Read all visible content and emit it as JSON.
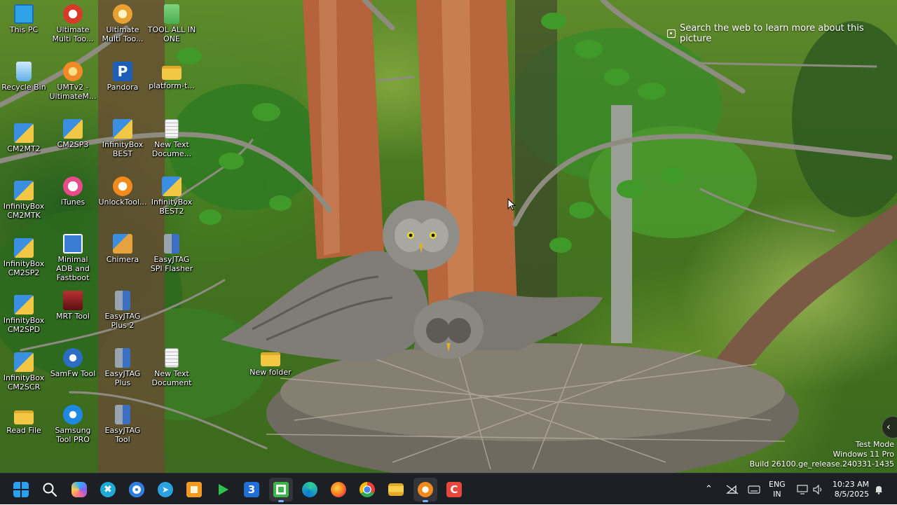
{
  "desktop": {
    "icons": [
      {
        "label": "This PC",
        "icon": "computer-icon",
        "color": "#2fa3e8"
      },
      {
        "label": "Ultimate Multi Too...",
        "icon": "umt-icon",
        "color": "#d7392b"
      },
      {
        "label": "Ultimate Multi Too...",
        "icon": "umt-icon",
        "color": "#e8a030"
      },
      {
        "label": "TOOL ALL IN ONE",
        "icon": "tool-icon",
        "color": "#4caf50"
      },
      {
        "label": "Recycle Bin",
        "icon": "recycle-bin-icon",
        "color": "#5fb0e8"
      },
      {
        "label": "UMTv2 - UltimateM...",
        "icon": "umt-icon",
        "color": "#f08a24"
      },
      {
        "label": "Pandora",
        "icon": "pandora-icon",
        "color": "#1d5fb8"
      },
      {
        "label": "platform-t...",
        "icon": "folder-icon",
        "color": "#f2c744"
      },
      {
        "label": "CM2MT2",
        "icon": "infinity-icon",
        "color": "#3b8fe0"
      },
      {
        "label": "CM2SP3",
        "icon": "infinity-icon",
        "color": "#3b8fe0"
      },
      {
        "label": "InfinityBox BEST",
        "icon": "infinity-icon",
        "color": "#3b8fe0"
      },
      {
        "label": "New Text Docume...",
        "icon": "text-document-icon",
        "color": "#f4f4f4"
      },
      {
        "label": "InfinityBox CM2MTK",
        "icon": "infinity-icon",
        "color": "#3b8fe0"
      },
      {
        "label": "iTunes",
        "icon": "itunes-icon",
        "color": "#e94b8a"
      },
      {
        "label": "UnlockTool...",
        "icon": "unlocktool-icon",
        "color": "#f28a1c"
      },
      {
        "label": "InfinityBox BEST2",
        "icon": "infinity-icon",
        "color": "#3b8fe0"
      },
      {
        "label": "InfinityBox CM2SP2",
        "icon": "infinity-icon",
        "color": "#3b8fe0"
      },
      {
        "label": "Minimal ADB and Fastboot",
        "icon": "adb-icon",
        "color": "#3a7bd5"
      },
      {
        "label": "Chimera",
        "icon": "chimera-icon",
        "color": "#e6a23c"
      },
      {
        "label": "EasyJTAG SPI Flasher",
        "icon": "easyjtag-icon",
        "color": "#9aa4b0"
      },
      {
        "label": "InfinityBox CM2SPD",
        "icon": "infinity-icon",
        "color": "#3b8fe0"
      },
      {
        "label": "MRT Tool",
        "icon": "mrt-icon",
        "color": "#b83232"
      },
      {
        "label": "EasyJTAG Plus 2",
        "icon": "easyjtag-icon",
        "color": "#9aa4b0"
      },
      {
        "label": "InfinityBox CM2SCR",
        "icon": "infinity-icon",
        "color": "#3b8fe0"
      },
      {
        "label": "SamFw Tool",
        "icon": "samfw-icon",
        "color": "#2b6cc4"
      },
      {
        "label": "EasyJTAG Plus",
        "icon": "easyjtag-icon",
        "color": "#9aa4b0"
      },
      {
        "label": "New Text Document",
        "icon": "text-document-icon",
        "color": "#f4f4f4"
      },
      {
        "label": "New folder",
        "icon": "folder-icon",
        "color": "#f2c744"
      },
      {
        "label": "Read File",
        "icon": "folder-icon",
        "color": "#f2c744"
      },
      {
        "label": "Samsung Tool PRO",
        "icon": "samsung-tool-icon",
        "color": "#1e88e5"
      },
      {
        "label": "EasyJTAG Tool",
        "icon": "easyjtag-icon",
        "color": "#9aa4b0"
      }
    ],
    "spotlight_text": "Search the web to learn more about this picture",
    "watermark": {
      "line1": "Test Mode",
      "line2": "Windows 11 Pro",
      "line3": "Build 26100.ge_release.240331-1435"
    }
  },
  "taskbar": {
    "apps": [
      {
        "name": "start",
        "icon": "windows-logo-icon"
      },
      {
        "name": "search",
        "icon": "search-icon"
      },
      {
        "name": "copilot",
        "icon": "copilot-icon"
      },
      {
        "name": "snipping-tool",
        "icon": "snipping-tool-icon"
      },
      {
        "name": "messaging",
        "icon": "chat-icon"
      },
      {
        "name": "telegram",
        "icon": "telegram-icon"
      },
      {
        "name": "recorder",
        "icon": "recorder-icon"
      },
      {
        "name": "play",
        "icon": "play-icon"
      },
      {
        "name": "app-3",
        "icon": "three-icon"
      },
      {
        "name": "camtasia",
        "icon": "camtasia-icon"
      },
      {
        "name": "edge",
        "icon": "edge-icon"
      },
      {
        "name": "firefox",
        "icon": "firefox-icon"
      },
      {
        "name": "chrome",
        "icon": "chrome-icon"
      },
      {
        "name": "file-explorer",
        "icon": "folder-icon"
      },
      {
        "name": "unlocktool",
        "icon": "unlocktool-icon"
      },
      {
        "name": "app-red",
        "icon": "red-app-icon"
      }
    ],
    "tray": {
      "language": "ENG",
      "region": "IN",
      "time": "10:23 AM",
      "date": "8/5/2025"
    }
  }
}
